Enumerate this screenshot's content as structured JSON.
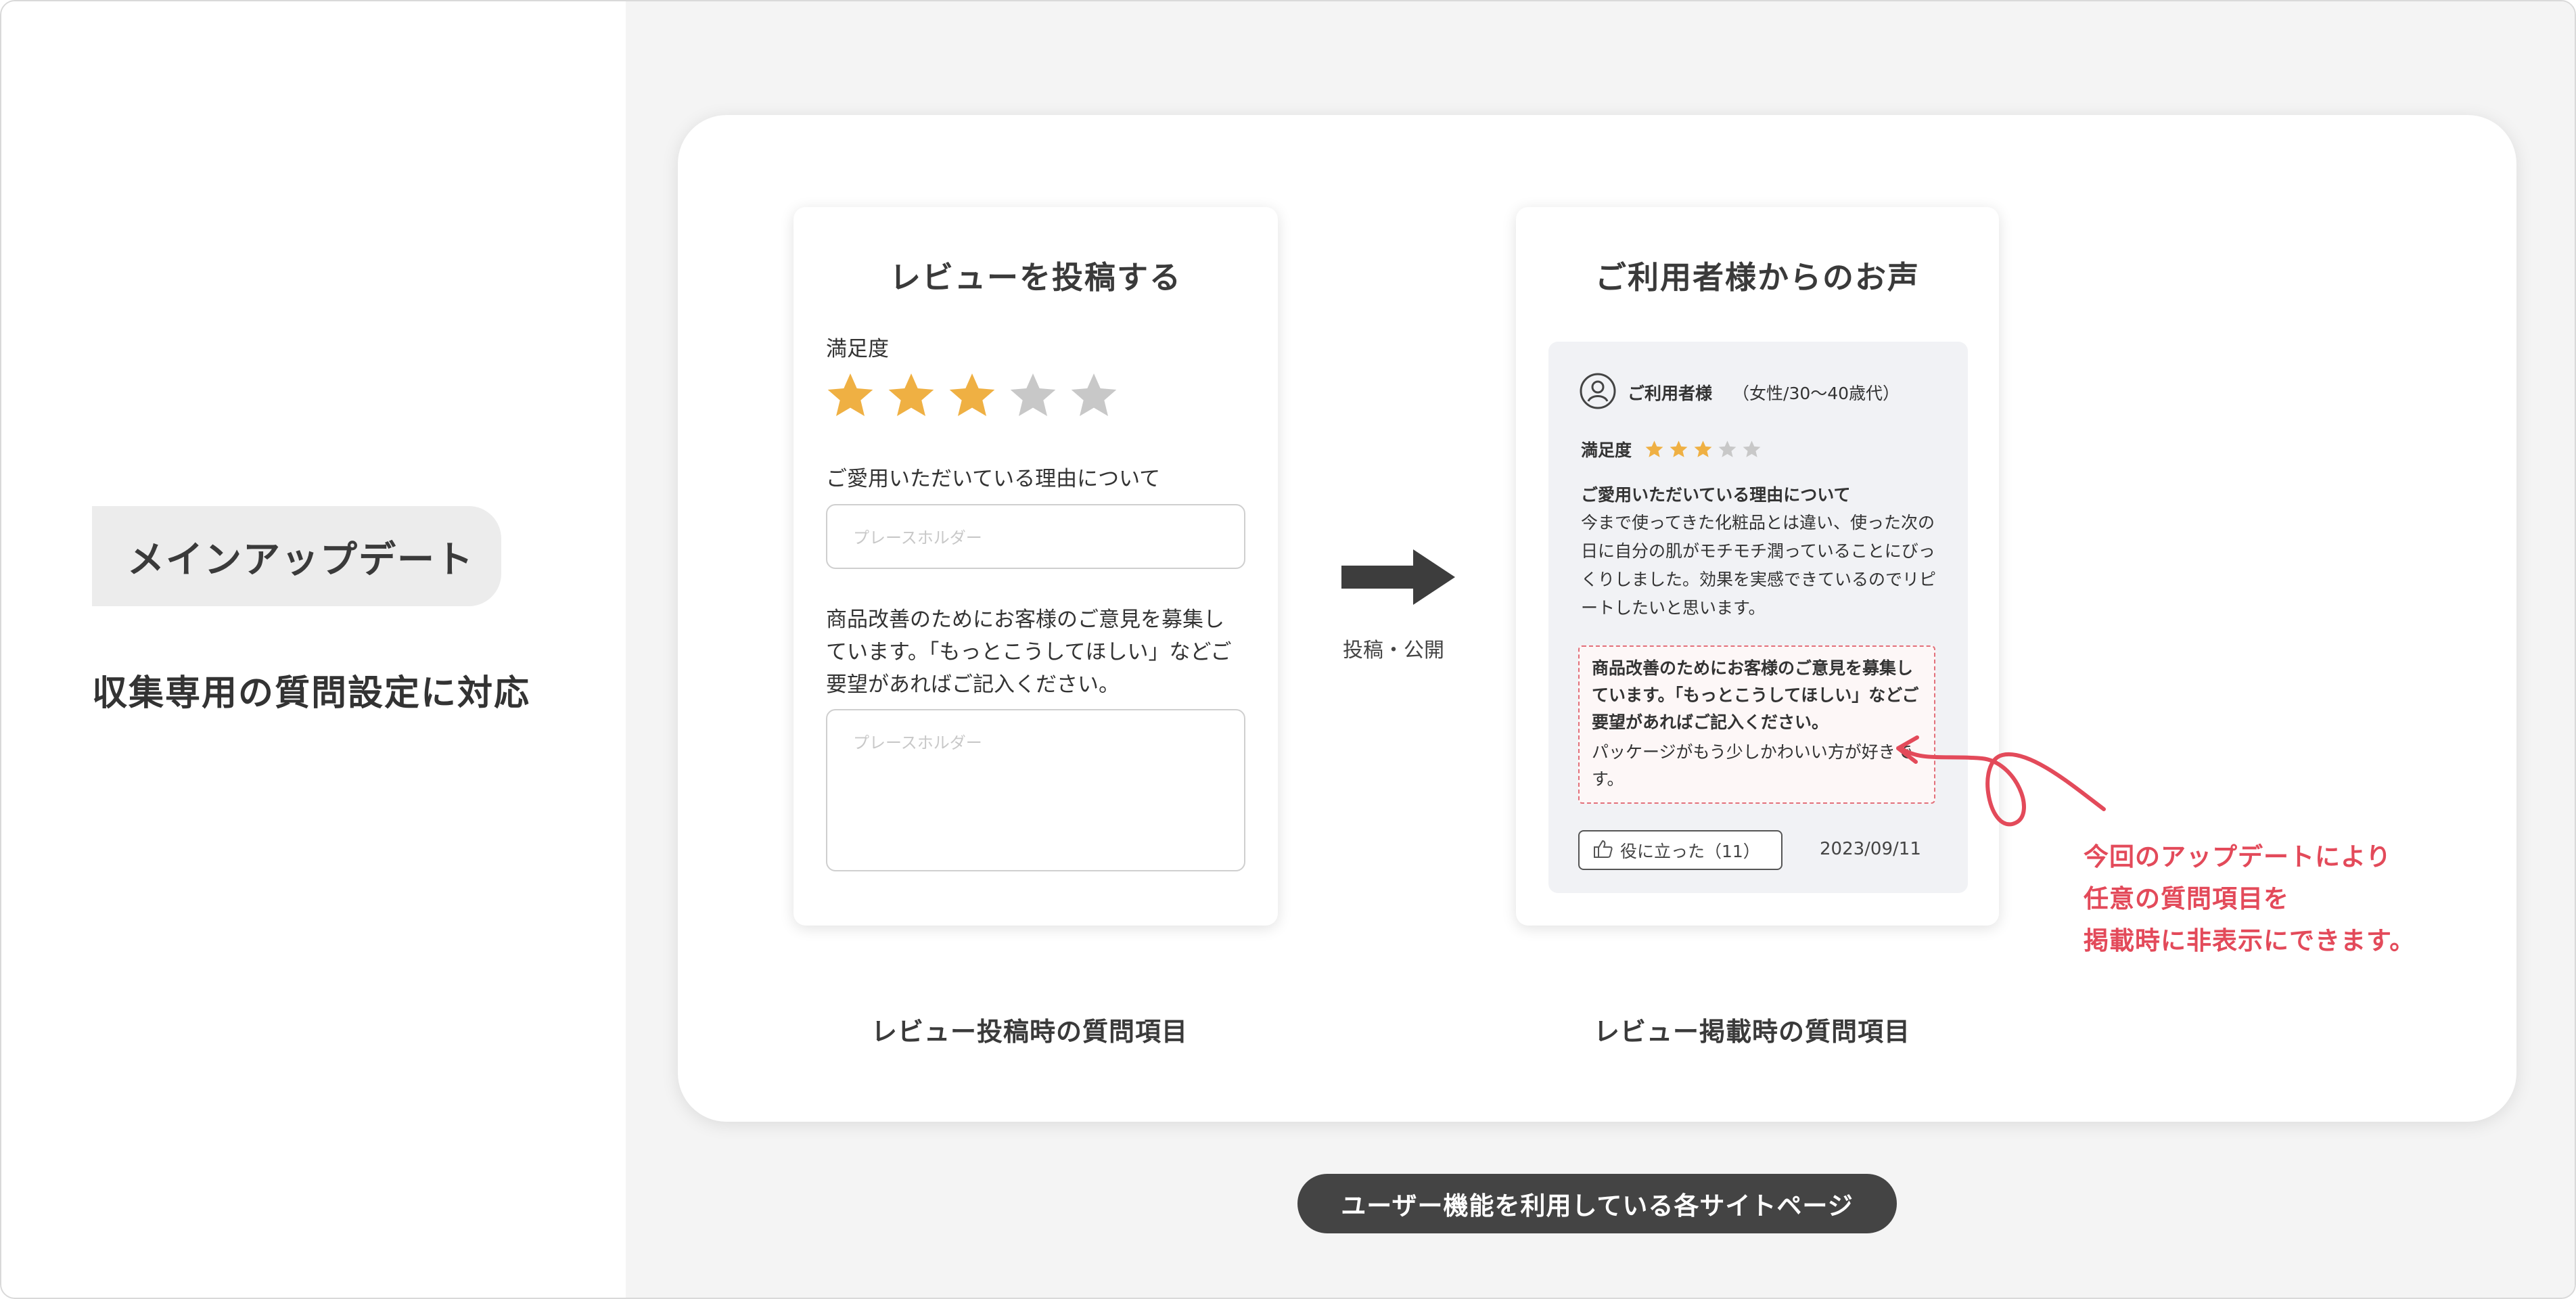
{
  "left": {
    "badge": "メインアップデート",
    "heading": "収集専用の質問設定に対応"
  },
  "colors": {
    "star_filled": "#efb043",
    "star_empty": "#c8c8c8",
    "accent": "#e34a5a",
    "pill_bg": "#444444"
  },
  "post_form": {
    "title": "レビューを投稿する",
    "satisfaction_label": "満足度",
    "rating": 3,
    "rating_max": 5,
    "reason_label": "ご愛用いただいている理由について",
    "reason_placeholder": "プレースホルダー",
    "improve_label": "商品改善のためにお客様のご意見を募集しています。「もっとこうしてほしい」などご要望があればご記入ください。",
    "improve_placeholder": "プレースホルダー"
  },
  "arrow": {
    "icon": "right-arrow-icon",
    "label": "投稿・公開"
  },
  "display": {
    "title": "ご利用者様からのお声",
    "user_icon": "user-circle-icon",
    "user_name": "ご利用者様",
    "user_meta": "（女性/30〜40歳代）",
    "satisfaction_label": "満足度",
    "rating": 3,
    "rating_max": 5,
    "q1_title": "ご愛用いただいている理由について",
    "q1_body": "今まで使ってきた化粧品とは違い、使った次の日に自分の肌がモチモチ潤っていることにびっくりしました。効果を実感できているのでリピートしたいと思います。",
    "q2_title": "商品改善のためにお客様のご意見を募集しています。「もっとこうしてほしい」などご要望があればご記入ください。",
    "q2_body": "パッケージがもう少しかわいい方が好きです。",
    "helpful_icon": "thumbs-up-icon",
    "helpful_label": "役に立った（11）",
    "date": "2023/09/11"
  },
  "captions": {
    "post": "レビュー投稿時の質問項目",
    "display": "レビュー掲載時の質問項目"
  },
  "note": "今回のアップデートにより\n任意の質問項目を\n掲載時に非表示にできます。",
  "footer_pill": "ユーザー機能を利用している各サイトページ"
}
